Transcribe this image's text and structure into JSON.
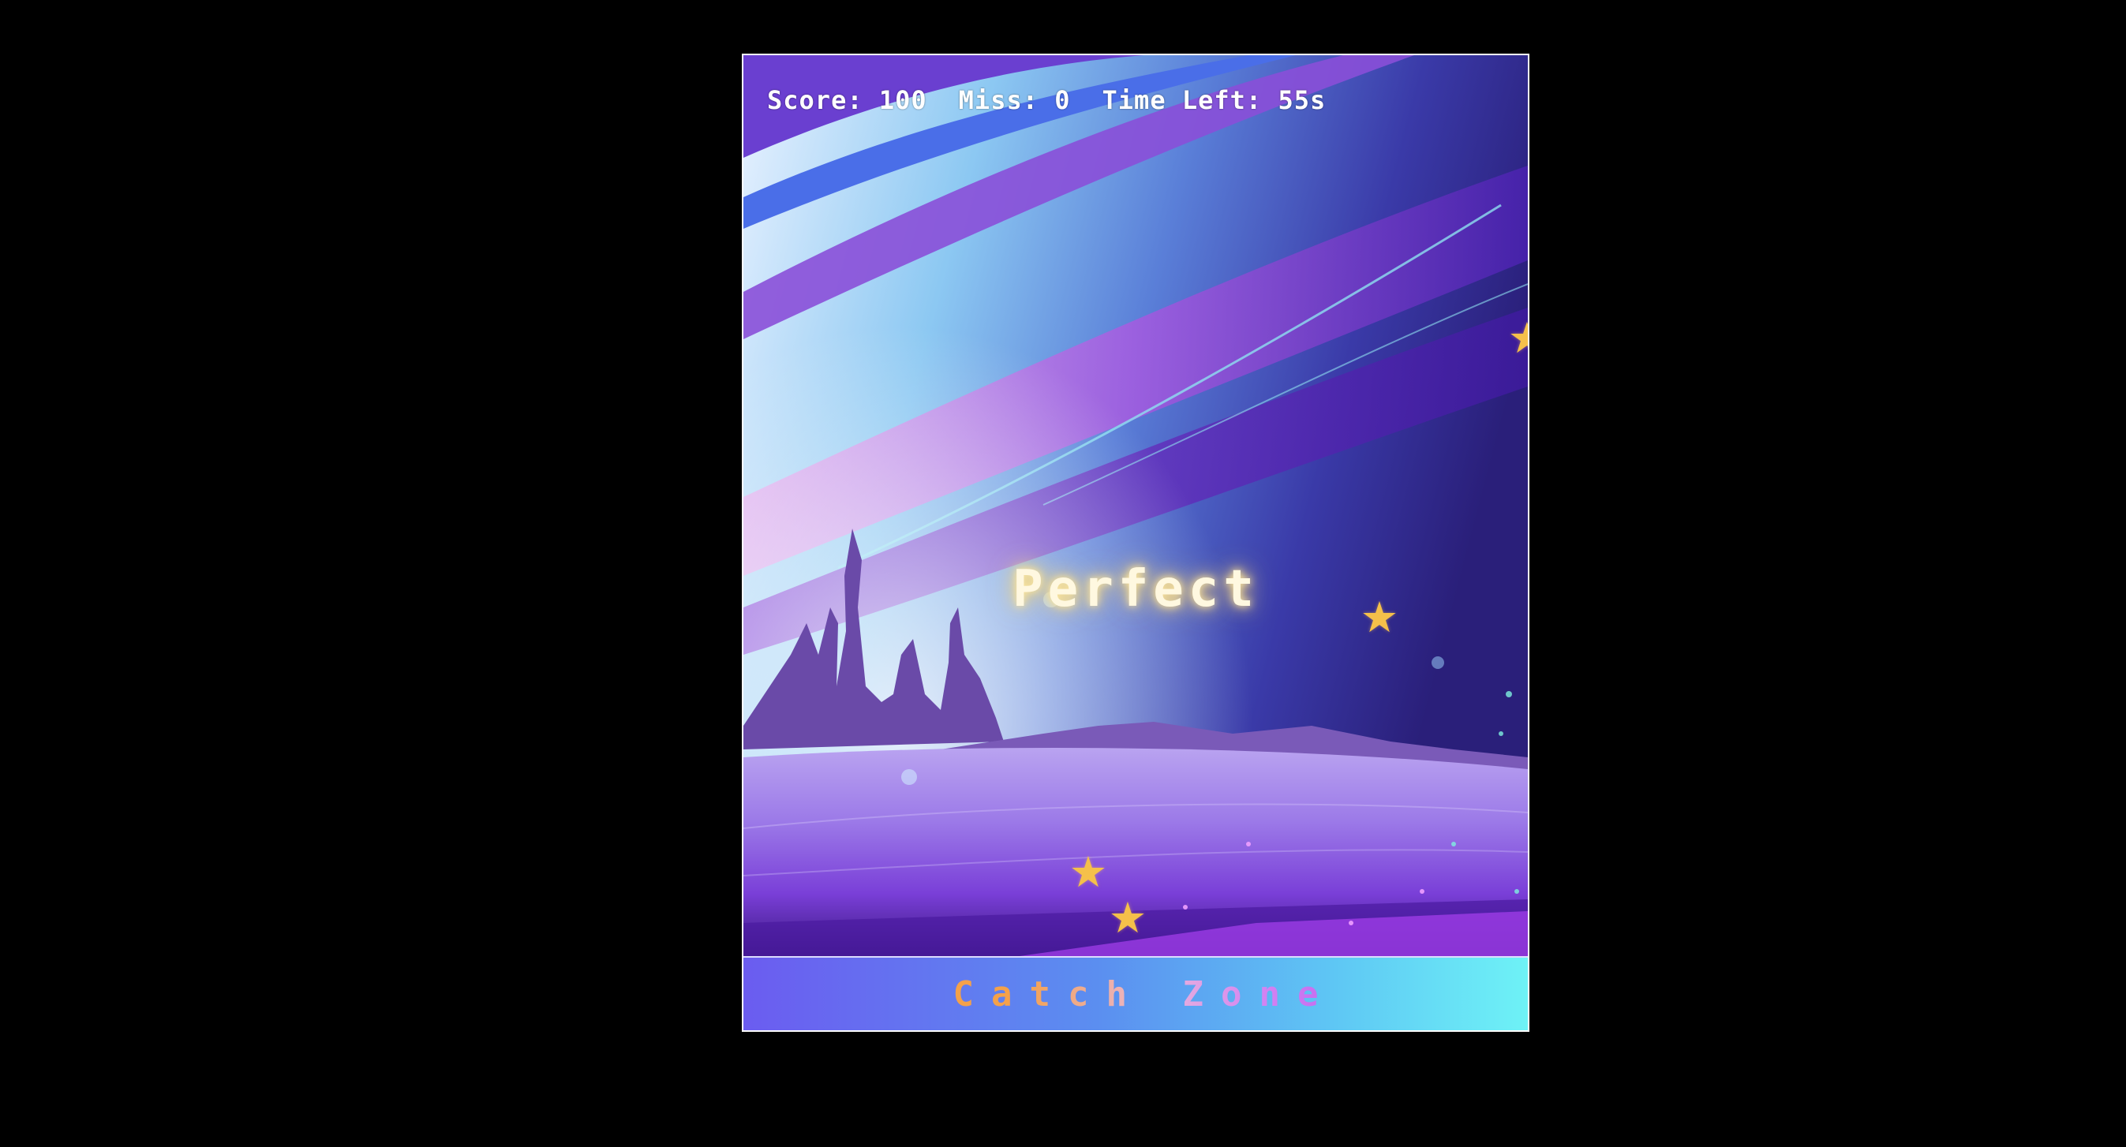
{
  "hud": {
    "score_label": "Score:",
    "score_value": "100",
    "miss_label": "Miss:",
    "miss_value": "0",
    "time_label": "Time Left:",
    "time_value": "55s"
  },
  "feedback": {
    "text": "Perfect"
  },
  "catch_zone": {
    "label": "Catch Zone"
  },
  "stars": {
    "icon": "star-icon",
    "glyph": "★",
    "color": "#f5c04a"
  },
  "colors": {
    "page_background": "#000000",
    "frame_border": "#ffffff",
    "star": "#f5c04a",
    "feedback_glow": "#ffd86b"
  }
}
